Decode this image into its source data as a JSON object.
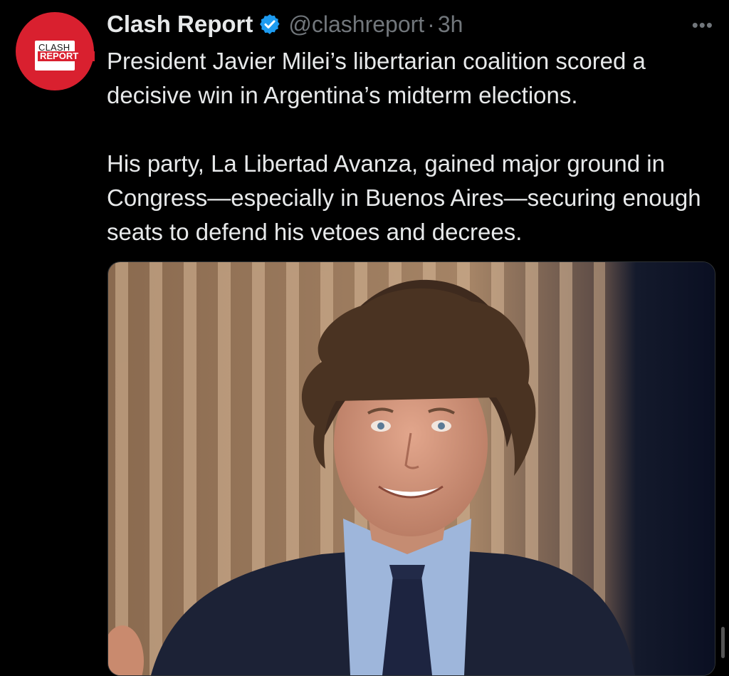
{
  "tweet": {
    "avatar": {
      "icon": "clash-report-logo",
      "line1": "CLASH",
      "line2": "REPORT"
    },
    "author_name": "Clash Report",
    "verified_icon": "verified-badge-icon",
    "handle": "@clashreport",
    "separator": "·",
    "timestamp": "3h",
    "more_label": "•••",
    "paragraphs": [
      "President Javier Milei’s libertarian coalition scored a decisive win in Argentina’s midterm elections.",
      "His party, La Libertad Avanza, gained major ground in Congress—especially in Buenos Aires—securing enough seats to defend his vetoes and decrees."
    ],
    "media": {
      "icon": "photo-of-smiling-man-in-suit"
    }
  },
  "colors": {
    "background": "#000000",
    "text": "#e7e9ea",
    "muted": "#71767b",
    "verified": "#1d9bf0",
    "brand": "#d9202f"
  }
}
